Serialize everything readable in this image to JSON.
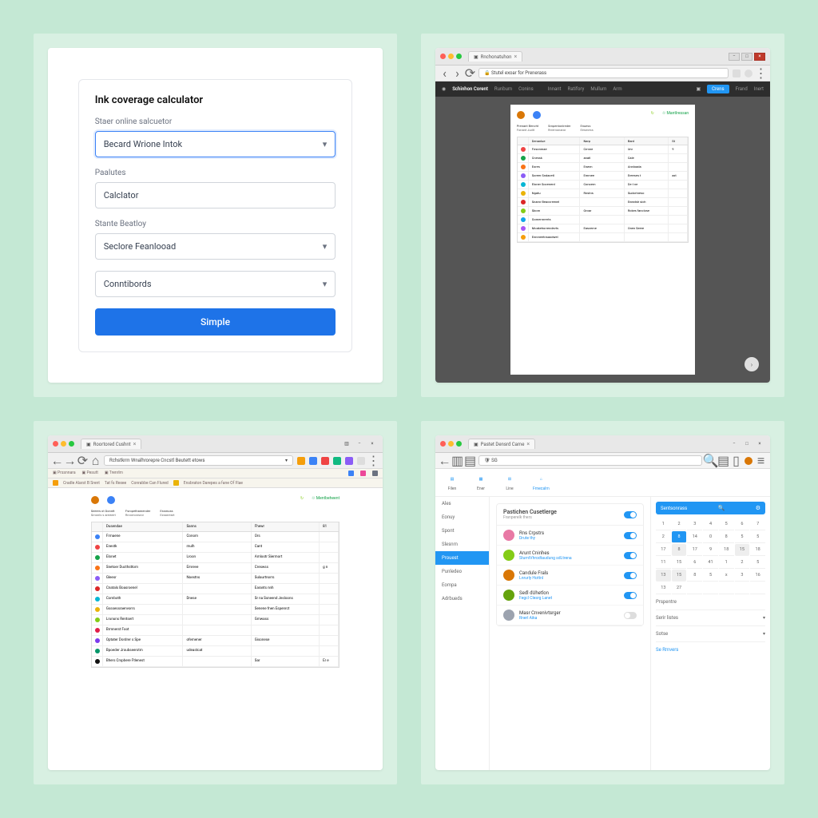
{
  "p1": {
    "title": "Ink coverage calculator",
    "label1": "Staer online salcuetor",
    "field1": "Becard Wrione Intok",
    "label2": "Paalutes",
    "field2": "Calclator",
    "label3": "Stante Beatloy",
    "field3": "Seclore Feanlooad",
    "field4": "Conntibords",
    "button": "Simple"
  },
  "p2": {
    "tab": "Rnchonatuhon",
    "url": "Stutel exoar for Prenerass",
    "brand": "Schinhon Corent",
    "nav": [
      "Runbum",
      "Conins",
      "Innant",
      "Ratifory",
      "Mullum",
      "Arm"
    ],
    "cta": "Crens",
    "right": [
      "Frand",
      "Inert"
    ],
    "doc_top_links": [
      "Mantlressan"
    ],
    "doc_sections": [
      {
        "h": "Prenant Bencht",
        "s": "Fonant Judit"
      },
      {
        "h": "Smpentonlreder",
        "s": "Rrremonaror"
      },
      {
        "h": "Enuess",
        "s": "Eesmess"
      }
    ],
    "cols": [
      "Denanlue",
      "Narp",
      "Bant",
      "St"
    ],
    "rows": [
      {
        "c": "#ef4444",
        "a": "Fnsonmae",
        "b": "Crmne",
        "d": "Unr",
        "e": "9"
      },
      {
        "c": "#16a34a",
        "a": "Cnessk",
        "b": "anatl",
        "d": "Cale",
        "e": ""
      },
      {
        "c": "#f97316",
        "a": "Eores",
        "b": "Enwm",
        "d": "Annloada",
        "e": ""
      },
      {
        "c": "#8b5cf6",
        "a": "Soreer Sndacetl",
        "b": "Emmee",
        "d": "Ereeses t",
        "e": "axt"
      },
      {
        "c": "#06b6d4",
        "a": "Eloner Socenerd",
        "b": "Conoem",
        "d": "De t ne",
        "e": ""
      },
      {
        "c": "#eab308",
        "a": "Ngatu",
        "b": "Rnstns",
        "d": "Sudortneso",
        "e": ""
      },
      {
        "c": "#dc2626",
        "a": "Snamr Beaccreenel",
        "b": "",
        "d": "Eneatsh sich",
        "e": ""
      },
      {
        "c": "#84cc16",
        "a": "Sborn",
        "b": "Oroar",
        "d": "Rokes fanclose",
        "e": ""
      },
      {
        "c": "#0ea5e9",
        "a": "Gomernrrerts",
        "b": "",
        "d": "",
        "e": ""
      },
      {
        "c": "#a855f7",
        "a": "Moakehorrendevts",
        "b": "Easceme",
        "d": "Onen Seere",
        "e": ""
      },
      {
        "c": "#f59e0b",
        "a": "Ennmeetnsaodwel",
        "b": "",
        "d": "",
        "e": ""
      }
    ]
  },
  "p3": {
    "tab": "Roortored Cushnt",
    "url": "Rchstkrm Wnalhrorepre Cncstl Beutett etows",
    "bookmarks1": [
      "Prssnnara",
      "Pesutt",
      "Trenrlm"
    ],
    "bookmarks2": [
      "Cradle Alarst B Srent",
      "Tat fs Rexee",
      "Conrabbe Can Flured",
      "Ensbraton Darepes a fane Of Flae"
    ],
    "doc_top_links": [
      "Mentbeheent"
    ],
    "doc_sections": [
      {
        "h": "Seeers ot Donntt",
        "s": "Smonls s arewert"
      },
      {
        "h": "Fsropethamender",
        "s": "Rrcomonsror"
      },
      {
        "h": "Essmuss",
        "s": "Exsarreart"
      }
    ],
    "cols": [
      "Dusendae",
      "Sanns",
      "Fhewr",
      "81"
    ],
    "rows": [
      {
        "c": "#3b82f6",
        "a": "Frmaene",
        "b": "Conom",
        "d": "Ors",
        "e": ""
      },
      {
        "c": "#ef4444",
        "a": "Enestk",
        "b": "mulh",
        "d": "Cant",
        "e": ""
      },
      {
        "c": "#16a34a",
        "a": "Elonet",
        "b": "Lroon",
        "d": "Amlootr Siermort",
        "e": ""
      },
      {
        "c": "#f97316",
        "a": "Snetoer Ducthsttom",
        "b": "Emreve",
        "d": "Creswss",
        "e": "g n"
      },
      {
        "c": "#8b5cf6",
        "a": "Gleesr",
        "b": "Noestns",
        "d": "Sulaurtnorrs",
        "e": ""
      },
      {
        "c": "#dc2626",
        "a": "Cnatals Boasroenel",
        "b": "",
        "d": "Earants nnh",
        "e": ""
      },
      {
        "c": "#06b6d4",
        "a": "Comboth",
        "b": "Dnese",
        "d": "Sr na Ssneend Jesloons",
        "e": ""
      },
      {
        "c": "#eab308",
        "a": "Gsssessraenvorrs",
        "b": "",
        "d": "Senene fnen Espenrct",
        "e": ""
      },
      {
        "c": "#84cc16",
        "a": "Lrununs Rentsert",
        "b": "",
        "d": "Gmwass",
        "e": ""
      },
      {
        "c": "#e11d48",
        "a": "Brmnerst Foot",
        "b": "",
        "d": "",
        "e": ""
      },
      {
        "c": "#7c3aed",
        "a": "Optater Dordrer s Spe",
        "b": "ofemener",
        "d": "Gisonese",
        "e": ""
      },
      {
        "c": "#059669",
        "a": "Bpoeder Jroubseerstm",
        "b": "udeastcat",
        "d": "",
        "e": ""
      },
      {
        "c": "#111",
        "a": "Bhers Crspbere Ftlenest",
        "b": "",
        "d": "Sar",
        "e": "Er e"
      }
    ]
  },
  "p4": {
    "tab": "Pastet Densrd Came",
    "addr_placeholder": "SG",
    "nav_icons": [
      "Filen",
      "Ener",
      "Line",
      "Frnecalm"
    ],
    "sidebar": [
      "Ales",
      "Eonuy",
      "Spont",
      "Slesnrn",
      "Prouest",
      "Punledeo",
      "Eompa",
      "Adrbueds"
    ],
    "sidebar_active": 4,
    "card_title": "Pastichen Cusetlerge",
    "card_sub": "Franperelk thers",
    "people": [
      {
        "c": "#e879a5",
        "n": "Rns Crpstrs",
        "s": "Drute thy",
        "on": true
      },
      {
        "c": "#84cc16",
        "n": "Arunt Cninhes",
        "s": "StumtVhrodtaudung sdLtrena",
        "on": true
      },
      {
        "c": "#d97706",
        "n": "Candule Frals",
        "s": "Lnrurly Hottnl",
        "on": true
      },
      {
        "c": "#65a30d",
        "n": "Sedl dUhetlon",
        "s": "Fegcl Clesrg Lanet",
        "on": true
      },
      {
        "c": "#9ca3af",
        "n": "Masr Cnvenivtsrger",
        "s": "Rnerl Aika",
        "on": false
      }
    ],
    "right_header": "Sentsonrass",
    "cal_rows": [
      [
        "1",
        "2",
        "3",
        "4",
        "5",
        "6",
        "7"
      ],
      [
        "2",
        "8",
        "14",
        "0",
        "8",
        "5",
        "5"
      ],
      [
        "17",
        "8",
        "17",
        "9",
        "18",
        "15",
        "18"
      ],
      [
        "11",
        "15",
        "6",
        "41",
        "1",
        "2",
        "5"
      ],
      [
        "13",
        "15",
        "8",
        "5",
        "x",
        "3",
        "16"
      ],
      [
        "13",
        "27",
        "",
        "",
        "",
        "",
        ""
      ]
    ],
    "cal_selected": "8",
    "opts": [
      "Prspentre",
      "Serir listes",
      "Sotse"
    ],
    "link": "Se Rmvers"
  }
}
